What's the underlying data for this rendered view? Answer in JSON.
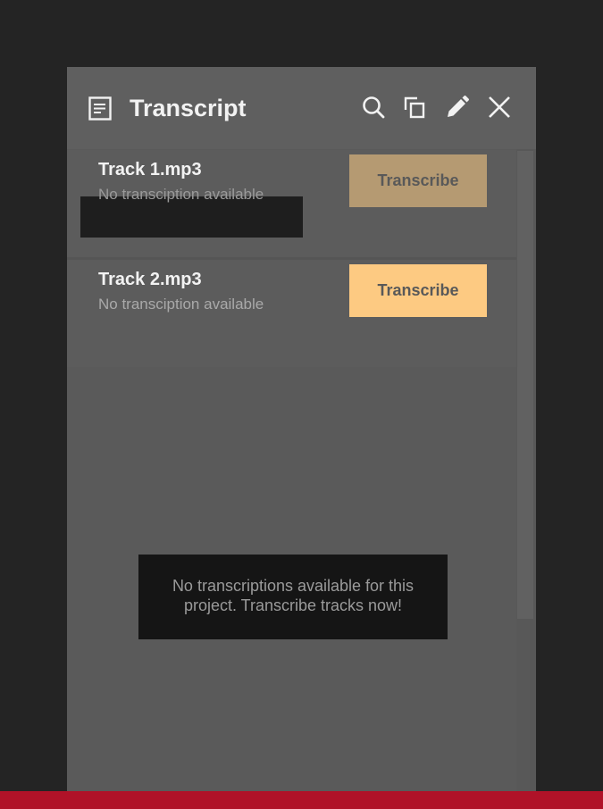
{
  "header": {
    "title": "Transcript",
    "icons": [
      "document-icon",
      "search-icon",
      "copy-icon",
      "pencil-icon",
      "close-icon"
    ]
  },
  "tracks": [
    {
      "name": "Track 1.mp3",
      "status": "No transciption available",
      "button_label": "Transcribe"
    },
    {
      "name": "Track 2.mp3",
      "status": "No transciption available",
      "button_label": "Transcribe"
    }
  ],
  "empty_state": {
    "line1": "No transcriptions available for this",
    "line2": "project. Transcribe tracks now!"
  },
  "colors": {
    "background": "#242424",
    "panel": "#5a5a5a",
    "accent_button": "#fdca82",
    "accent_button_dim": "#b59a72",
    "bottom_bar": "#b01228"
  }
}
